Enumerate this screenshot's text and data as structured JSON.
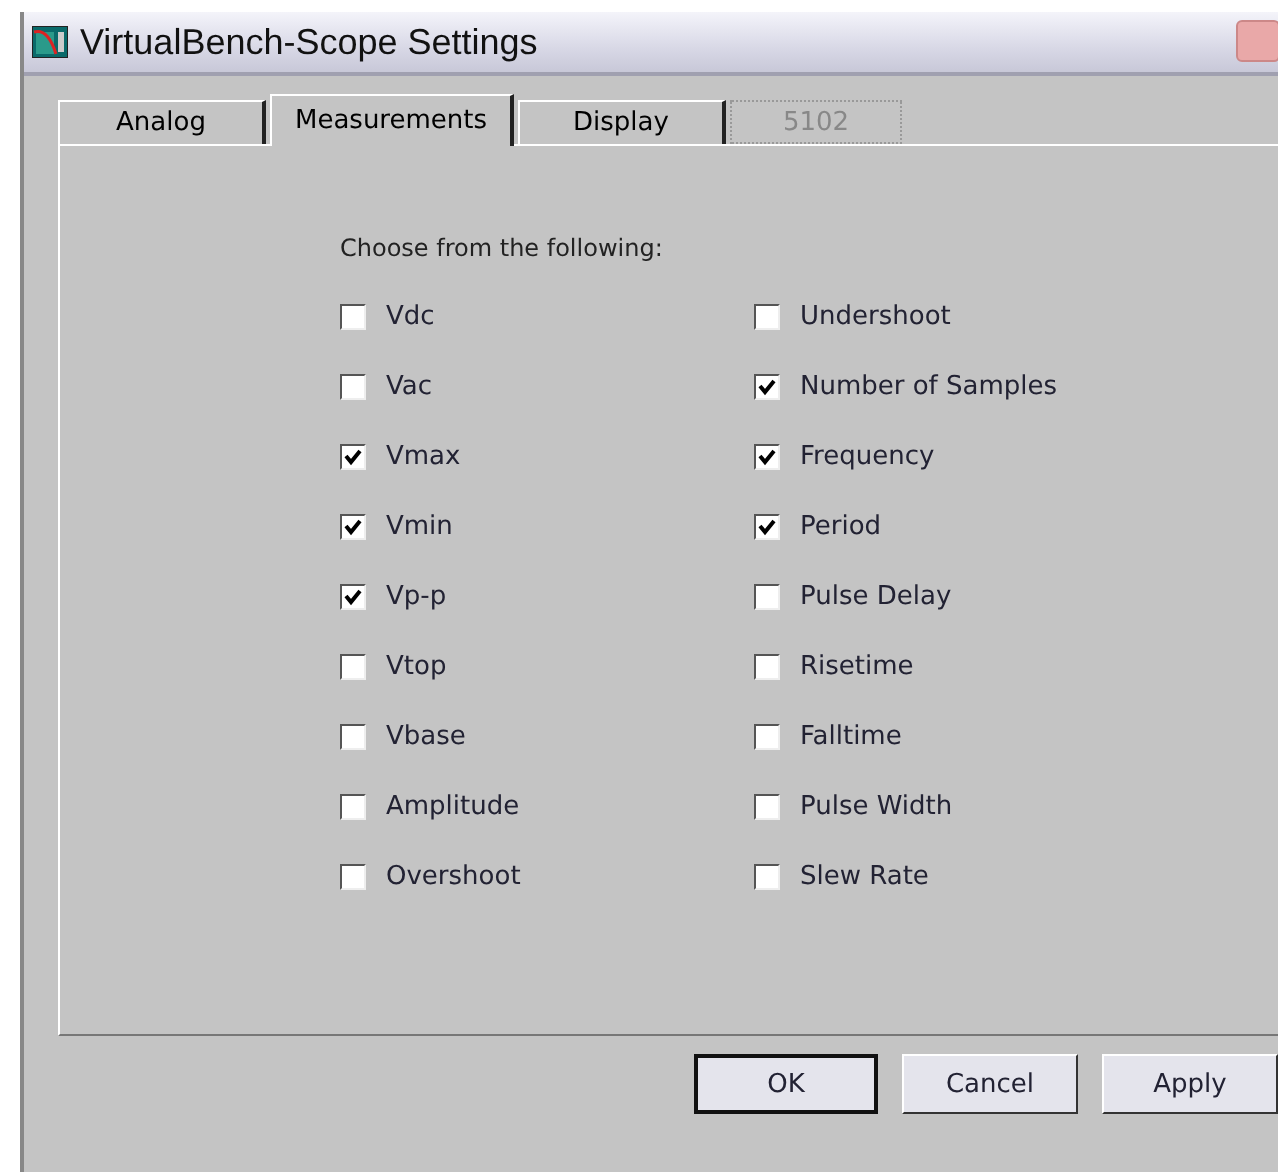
{
  "window": {
    "title": "VirtualBench-Scope Settings"
  },
  "tabs": [
    {
      "label": "Analog",
      "selected": false,
      "disabled": false
    },
    {
      "label": "Measurements",
      "selected": true,
      "disabled": false
    },
    {
      "label": "Display",
      "selected": false,
      "disabled": false
    },
    {
      "label": "5102",
      "selected": false,
      "disabled": true
    }
  ],
  "prompt": "Choose from the following:",
  "columns": [
    [
      {
        "label": "Vdc",
        "checked": false
      },
      {
        "label": "Vac",
        "checked": false
      },
      {
        "label": "Vmax",
        "checked": true
      },
      {
        "label": "Vmin",
        "checked": true
      },
      {
        "label": "Vp-p",
        "checked": true
      },
      {
        "label": "Vtop",
        "checked": false
      },
      {
        "label": "Vbase",
        "checked": false
      },
      {
        "label": "Amplitude",
        "checked": false
      },
      {
        "label": "Overshoot",
        "checked": false
      }
    ],
    [
      {
        "label": "Undershoot",
        "checked": false
      },
      {
        "label": "Number of Samples",
        "checked": true
      },
      {
        "label": "Frequency",
        "checked": true
      },
      {
        "label": "Period",
        "checked": true
      },
      {
        "label": "Pulse Delay",
        "checked": false
      },
      {
        "label": "Risetime",
        "checked": false
      },
      {
        "label": "Falltime",
        "checked": false
      },
      {
        "label": "Pulse Width",
        "checked": false
      },
      {
        "label": "Slew Rate",
        "checked": false
      }
    ]
  ],
  "buttons": [
    {
      "label": "OK",
      "default": true
    },
    {
      "label": "Cancel",
      "default": false
    },
    {
      "label": "Apply",
      "default": false
    }
  ]
}
